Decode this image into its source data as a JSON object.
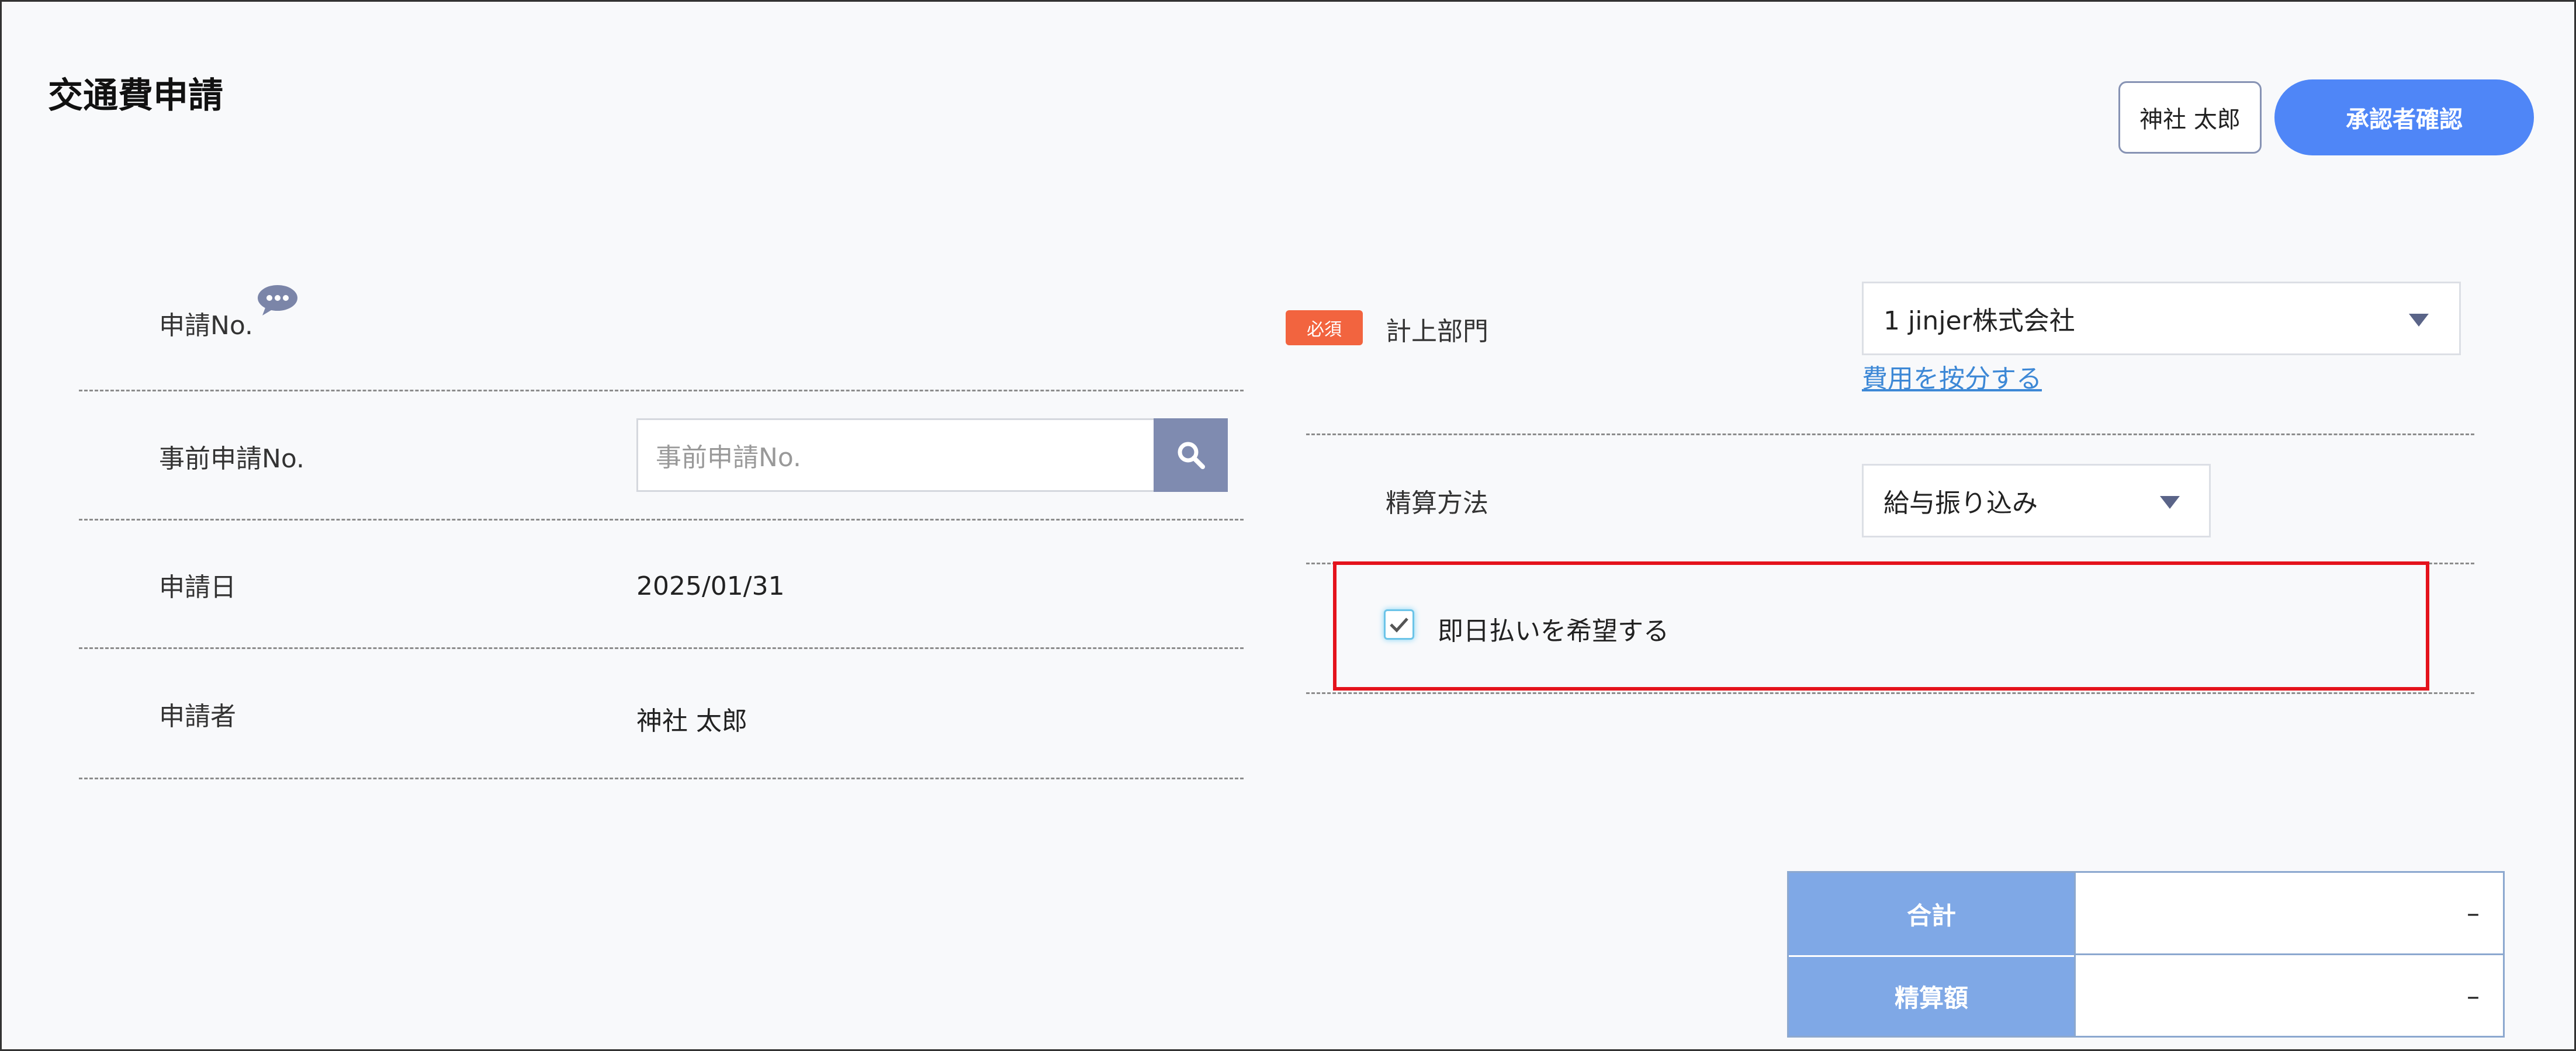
{
  "page": {
    "title": "交通費申請"
  },
  "header": {
    "user_button": "神社 太郎",
    "approver_button": "承認者確認"
  },
  "left_form": {
    "application_no": {
      "label": "申請No."
    },
    "prior_application_no": {
      "label": "事前申請No.",
      "placeholder": "事前申請No."
    },
    "application_date": {
      "label": "申請日",
      "value": "2025/01/31"
    },
    "applicant": {
      "label": "申請者",
      "value": "神社 太郎"
    }
  },
  "right_form": {
    "department": {
      "required_badge": "必須",
      "label": "計上部門",
      "selected": "1 jinjer株式会社",
      "split_link": "費用を按分する"
    },
    "settlement_method": {
      "label": "精算方法",
      "selected": "給与振り込み"
    },
    "same_day_payment": {
      "label": "即日払いを希望する",
      "checked": true
    }
  },
  "totals": {
    "total_label": "合計",
    "total_value": "–",
    "settlement_label": "精算額",
    "settlement_value": "–"
  },
  "colors": {
    "accent": "#4f86f7",
    "required": "#f2643f",
    "highlight": "#e4131c",
    "table_header": "#7fa8e6"
  }
}
